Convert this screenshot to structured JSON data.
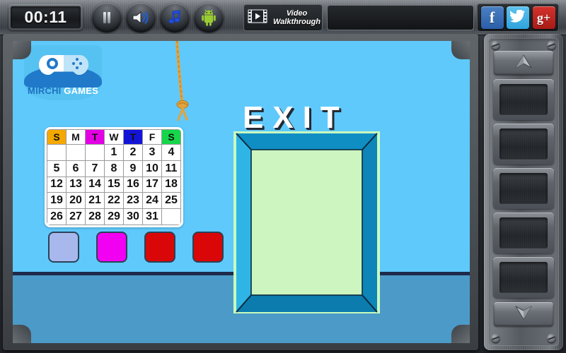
{
  "topbar": {
    "timer": "00:11",
    "buttons": [
      {
        "name": "pause-button",
        "icon": "pause-icon"
      },
      {
        "name": "sound-button",
        "icon": "speaker-icon"
      },
      {
        "name": "music-button",
        "icon": "music-note-icon"
      },
      {
        "name": "android-button",
        "icon": "android-icon"
      }
    ],
    "video_walkthrough": {
      "line1": "Video",
      "line2": "Walkthrough",
      "icon": "film-play-icon"
    },
    "ad_banner": "",
    "social": [
      {
        "name": "facebook-button",
        "label": "f",
        "color": "#2a5fa8"
      },
      {
        "name": "twitter-button",
        "label": "🐦",
        "color": "#2fa3dd"
      },
      {
        "name": "googleplus-button",
        "label": "g+",
        "color": "#a81b17"
      }
    ]
  },
  "logo": {
    "word1": "MIRCHI",
    "word2": "GAMES",
    "icon": "gamepad-icon"
  },
  "scene": {
    "exit_sign": "EXIT",
    "wall_color": "#5fc9fc",
    "floor_color": "#4c9ac8",
    "door": {
      "frame_color": "#1a9ed4",
      "panel_color": "#ccf5c0",
      "highlight_color": "#c9fbbd"
    },
    "rope": {
      "name": "hanging-rope",
      "color": "#e2a33c"
    }
  },
  "calendar": {
    "headers": [
      {
        "label": "S",
        "color": "orange"
      },
      {
        "label": "M",
        "color": "white"
      },
      {
        "label": "T",
        "color": "magenta"
      },
      {
        "label": "W",
        "color": "white"
      },
      {
        "label": "T",
        "color": "blue"
      },
      {
        "label": "F",
        "color": "white"
      },
      {
        "label": "S",
        "color": "green"
      }
    ],
    "weeks": [
      [
        "",
        "",
        "",
        "1",
        "2",
        "3",
        "4"
      ],
      [
        "5",
        "6",
        "7",
        "8",
        "9",
        "10",
        "11"
      ],
      [
        "12",
        "13",
        "14",
        "15",
        "16",
        "17",
        "18"
      ],
      [
        "19",
        "20",
        "21",
        "22",
        "23",
        "24",
        "25"
      ],
      [
        "26",
        "27",
        "28",
        "29",
        "30",
        "31",
        ""
      ]
    ],
    "header_colors": {
      "orange": "#f5a800",
      "magenta": "#e400e4",
      "blue": "#1414d8",
      "green": "#18d64a",
      "white": "#ffffff"
    }
  },
  "swatches": [
    {
      "name": "swatch-periwinkle",
      "color": "#a8b8ec"
    },
    {
      "name": "swatch-magenta",
      "color": "#f200f2"
    },
    {
      "name": "swatch-red-1",
      "color": "#d90707"
    },
    {
      "name": "swatch-red-2",
      "color": "#d90707"
    }
  ],
  "inventory": {
    "up_arrow": "scroll-up-arrow",
    "down_arrow": "scroll-down-arrow",
    "slots": [
      {
        "name": "inventory-slot-1",
        "item": ""
      },
      {
        "name": "inventory-slot-2",
        "item": ""
      },
      {
        "name": "inventory-slot-3",
        "item": ""
      },
      {
        "name": "inventory-slot-4",
        "item": ""
      },
      {
        "name": "inventory-slot-5",
        "item": ""
      }
    ]
  }
}
